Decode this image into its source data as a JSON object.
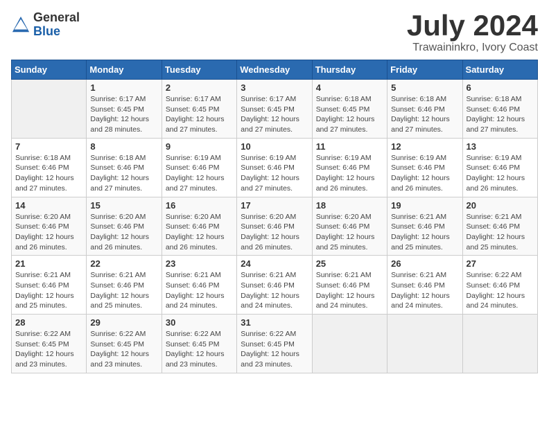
{
  "header": {
    "logo_general": "General",
    "logo_blue": "Blue",
    "month_title": "July 2024",
    "location": "Trawaininkro, Ivory Coast"
  },
  "calendar": {
    "days_of_week": [
      "Sunday",
      "Monday",
      "Tuesday",
      "Wednesday",
      "Thursday",
      "Friday",
      "Saturday"
    ],
    "weeks": [
      [
        {
          "day": "",
          "sunrise": "",
          "sunset": "",
          "daylight": ""
        },
        {
          "day": "1",
          "sunrise": "Sunrise: 6:17 AM",
          "sunset": "Sunset: 6:45 PM",
          "daylight": "Daylight: 12 hours and 28 minutes."
        },
        {
          "day": "2",
          "sunrise": "Sunrise: 6:17 AM",
          "sunset": "Sunset: 6:45 PM",
          "daylight": "Daylight: 12 hours and 27 minutes."
        },
        {
          "day": "3",
          "sunrise": "Sunrise: 6:17 AM",
          "sunset": "Sunset: 6:45 PM",
          "daylight": "Daylight: 12 hours and 27 minutes."
        },
        {
          "day": "4",
          "sunrise": "Sunrise: 6:18 AM",
          "sunset": "Sunset: 6:45 PM",
          "daylight": "Daylight: 12 hours and 27 minutes."
        },
        {
          "day": "5",
          "sunrise": "Sunrise: 6:18 AM",
          "sunset": "Sunset: 6:46 PM",
          "daylight": "Daylight: 12 hours and 27 minutes."
        },
        {
          "day": "6",
          "sunrise": "Sunrise: 6:18 AM",
          "sunset": "Sunset: 6:46 PM",
          "daylight": "Daylight: 12 hours and 27 minutes."
        }
      ],
      [
        {
          "day": "7",
          "sunrise": "Sunrise: 6:18 AM",
          "sunset": "Sunset: 6:46 PM",
          "daylight": "Daylight: 12 hours and 27 minutes."
        },
        {
          "day": "8",
          "sunrise": "Sunrise: 6:18 AM",
          "sunset": "Sunset: 6:46 PM",
          "daylight": "Daylight: 12 hours and 27 minutes."
        },
        {
          "day": "9",
          "sunrise": "Sunrise: 6:19 AM",
          "sunset": "Sunset: 6:46 PM",
          "daylight": "Daylight: 12 hours and 27 minutes."
        },
        {
          "day": "10",
          "sunrise": "Sunrise: 6:19 AM",
          "sunset": "Sunset: 6:46 PM",
          "daylight": "Daylight: 12 hours and 27 minutes."
        },
        {
          "day": "11",
          "sunrise": "Sunrise: 6:19 AM",
          "sunset": "Sunset: 6:46 PM",
          "daylight": "Daylight: 12 hours and 26 minutes."
        },
        {
          "day": "12",
          "sunrise": "Sunrise: 6:19 AM",
          "sunset": "Sunset: 6:46 PM",
          "daylight": "Daylight: 12 hours and 26 minutes."
        },
        {
          "day": "13",
          "sunrise": "Sunrise: 6:19 AM",
          "sunset": "Sunset: 6:46 PM",
          "daylight": "Daylight: 12 hours and 26 minutes."
        }
      ],
      [
        {
          "day": "14",
          "sunrise": "Sunrise: 6:20 AM",
          "sunset": "Sunset: 6:46 PM",
          "daylight": "Daylight: 12 hours and 26 minutes."
        },
        {
          "day": "15",
          "sunrise": "Sunrise: 6:20 AM",
          "sunset": "Sunset: 6:46 PM",
          "daylight": "Daylight: 12 hours and 26 minutes."
        },
        {
          "day": "16",
          "sunrise": "Sunrise: 6:20 AM",
          "sunset": "Sunset: 6:46 PM",
          "daylight": "Daylight: 12 hours and 26 minutes."
        },
        {
          "day": "17",
          "sunrise": "Sunrise: 6:20 AM",
          "sunset": "Sunset: 6:46 PM",
          "daylight": "Daylight: 12 hours and 26 minutes."
        },
        {
          "day": "18",
          "sunrise": "Sunrise: 6:20 AM",
          "sunset": "Sunset: 6:46 PM",
          "daylight": "Daylight: 12 hours and 25 minutes."
        },
        {
          "day": "19",
          "sunrise": "Sunrise: 6:21 AM",
          "sunset": "Sunset: 6:46 PM",
          "daylight": "Daylight: 12 hours and 25 minutes."
        },
        {
          "day": "20",
          "sunrise": "Sunrise: 6:21 AM",
          "sunset": "Sunset: 6:46 PM",
          "daylight": "Daylight: 12 hours and 25 minutes."
        }
      ],
      [
        {
          "day": "21",
          "sunrise": "Sunrise: 6:21 AM",
          "sunset": "Sunset: 6:46 PM",
          "daylight": "Daylight: 12 hours and 25 minutes."
        },
        {
          "day": "22",
          "sunrise": "Sunrise: 6:21 AM",
          "sunset": "Sunset: 6:46 PM",
          "daylight": "Daylight: 12 hours and 25 minutes."
        },
        {
          "day": "23",
          "sunrise": "Sunrise: 6:21 AM",
          "sunset": "Sunset: 6:46 PM",
          "daylight": "Daylight: 12 hours and 24 minutes."
        },
        {
          "day": "24",
          "sunrise": "Sunrise: 6:21 AM",
          "sunset": "Sunset: 6:46 PM",
          "daylight": "Daylight: 12 hours and 24 minutes."
        },
        {
          "day": "25",
          "sunrise": "Sunrise: 6:21 AM",
          "sunset": "Sunset: 6:46 PM",
          "daylight": "Daylight: 12 hours and 24 minutes."
        },
        {
          "day": "26",
          "sunrise": "Sunrise: 6:21 AM",
          "sunset": "Sunset: 6:46 PM",
          "daylight": "Daylight: 12 hours and 24 minutes."
        },
        {
          "day": "27",
          "sunrise": "Sunrise: 6:22 AM",
          "sunset": "Sunset: 6:46 PM",
          "daylight": "Daylight: 12 hours and 24 minutes."
        }
      ],
      [
        {
          "day": "28",
          "sunrise": "Sunrise: 6:22 AM",
          "sunset": "Sunset: 6:45 PM",
          "daylight": "Daylight: 12 hours and 23 minutes."
        },
        {
          "day": "29",
          "sunrise": "Sunrise: 6:22 AM",
          "sunset": "Sunset: 6:45 PM",
          "daylight": "Daylight: 12 hours and 23 minutes."
        },
        {
          "day": "30",
          "sunrise": "Sunrise: 6:22 AM",
          "sunset": "Sunset: 6:45 PM",
          "daylight": "Daylight: 12 hours and 23 minutes."
        },
        {
          "day": "31",
          "sunrise": "Sunrise: 6:22 AM",
          "sunset": "Sunset: 6:45 PM",
          "daylight": "Daylight: 12 hours and 23 minutes."
        },
        {
          "day": "",
          "sunrise": "",
          "sunset": "",
          "daylight": ""
        },
        {
          "day": "",
          "sunrise": "",
          "sunset": "",
          "daylight": ""
        },
        {
          "day": "",
          "sunrise": "",
          "sunset": "",
          "daylight": ""
        }
      ]
    ]
  }
}
